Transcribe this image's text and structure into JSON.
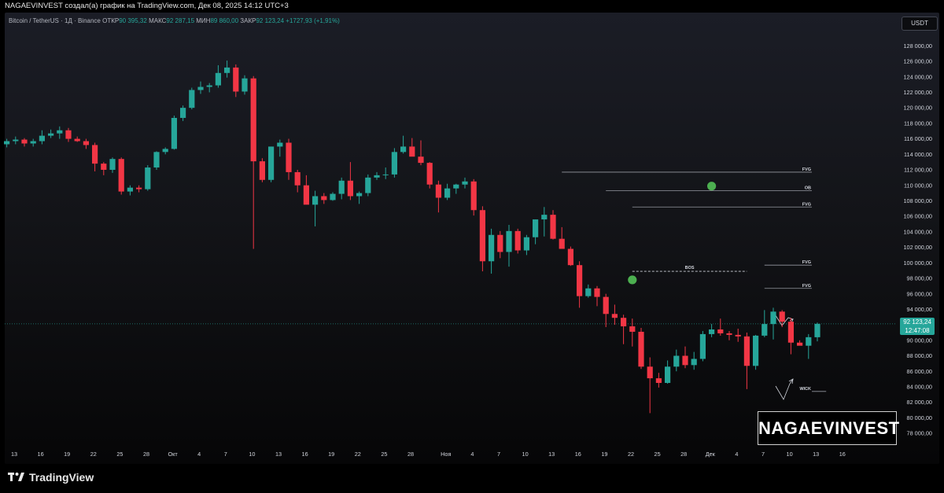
{
  "header": {
    "title": "NAGAEVINVEST создал(а) график на TradingView.com, Дек 08, 2025 14:12 UTC+3"
  },
  "ohlc": {
    "symbol": "Bitcoin / TetherUS · 1Д · Binance",
    "open_label": "ОТКР",
    "open": "90 395,32",
    "high_label": "МАКС",
    "high": "92 287,15",
    "low_label": "МИН",
    "low": "89 860,00",
    "close_label": "ЗАКР",
    "close": "92 123,24",
    "change": "+1727,93 (+1,91%)"
  },
  "currency": "USDT",
  "current_price": {
    "price": "92 123,24",
    "countdown": "12:47:08"
  },
  "watermark": "NAGAEVINVEST",
  "footer": {
    "logo_text": "TradingView"
  },
  "colors": {
    "up": "#26a69a",
    "down": "#f23645",
    "level_line": "#9598a1",
    "marker": "#4caf50",
    "price_line": "#26a69a"
  },
  "chart_data": {
    "type": "candlestick",
    "title": "Bitcoin / TetherUS · 1Д · Binance",
    "ylim": [
      77000,
      129000
    ],
    "y_ticks": [
      78000,
      80000,
      82000,
      84000,
      86000,
      88000,
      90000,
      92000,
      94000,
      96000,
      98000,
      100000,
      102000,
      104000,
      106000,
      108000,
      110000,
      112000,
      114000,
      116000,
      118000,
      120000,
      122000,
      124000,
      126000,
      128000
    ],
    "y_tick_labels": [
      "78 000,00",
      "80 000,00",
      "82 000,00",
      "84 000,00",
      "86 000,00",
      "88 000,00",
      "90 000,00",
      "92 000,00",
      "94 000,00",
      "96 000,00",
      "98 000,00",
      "100 000,00",
      "102 000,00",
      "104 000,00",
      "106 000,00",
      "108 000,00",
      "110 000,00",
      "112 000,00",
      "114 000,00",
      "116 000,00",
      "118 000,00",
      "120 000,00",
      "122 000,00",
      "124 000,00",
      "126 000,00",
      "128 000,00"
    ],
    "x_ticks": [
      {
        "label": "13",
        "i": 0
      },
      {
        "label": "16",
        "i": 3
      },
      {
        "label": "19",
        "i": 6
      },
      {
        "label": "22",
        "i": 9
      },
      {
        "label": "25",
        "i": 12
      },
      {
        "label": "28",
        "i": 15
      },
      {
        "label": "Окт",
        "i": 18
      },
      {
        "label": "4",
        "i": 21
      },
      {
        "label": "7",
        "i": 24
      },
      {
        "label": "10",
        "i": 27
      },
      {
        "label": "13",
        "i": 30
      },
      {
        "label": "16",
        "i": 33
      },
      {
        "label": "19",
        "i": 36
      },
      {
        "label": "22",
        "i": 39
      },
      {
        "label": "25",
        "i": 42
      },
      {
        "label": "28",
        "i": 45
      },
      {
        "label": "Ноя",
        "i": 49
      },
      {
        "label": "4",
        "i": 52
      },
      {
        "label": "7",
        "i": 55
      },
      {
        "label": "10",
        "i": 58
      },
      {
        "label": "13",
        "i": 61
      },
      {
        "label": "16",
        "i": 64
      },
      {
        "label": "19",
        "i": 67
      },
      {
        "label": "22",
        "i": 70
      },
      {
        "label": "25",
        "i": 73
      },
      {
        "label": "28",
        "i": 76
      },
      {
        "label": "Дек",
        "i": 79
      },
      {
        "label": "4",
        "i": 82
      },
      {
        "label": "7",
        "i": 85
      },
      {
        "label": "10",
        "i": 88
      },
      {
        "label": "13",
        "i": 91
      },
      {
        "label": "16",
        "i": 94
      }
    ],
    "candles": [
      [
        115300,
        116000,
        114900,
        115700
      ],
      [
        115700,
        116300,
        115300,
        115900
      ],
      [
        115900,
        116100,
        115000,
        115400
      ],
      [
        115400,
        116000,
        115000,
        115700
      ],
      [
        115700,
        117100,
        115300,
        116400
      ],
      [
        116400,
        117200,
        116100,
        116700
      ],
      [
        116700,
        117600,
        116000,
        117100
      ],
      [
        117100,
        117400,
        115600,
        116000
      ],
      [
        116000,
        116300,
        115600,
        115700
      ],
      [
        115700,
        116000,
        114700,
        115200
      ],
      [
        115200,
        115500,
        111800,
        112800
      ],
      [
        112800,
        113000,
        111300,
        112000
      ],
      [
        112000,
        113600,
        111600,
        113400
      ],
      [
        113400,
        113600,
        108800,
        109200
      ],
      [
        109200,
        110000,
        108700,
        109700
      ],
      [
        109700,
        110000,
        109100,
        109500
      ],
      [
        109500,
        112600,
        109300,
        112300
      ],
      [
        112300,
        114400,
        112000,
        114300
      ],
      [
        114300,
        114900,
        114000,
        114700
      ],
      [
        114700,
        119000,
        114600,
        118700
      ],
      [
        118700,
        120300,
        118300,
        120000
      ],
      [
        120000,
        122600,
        119800,
        122300
      ],
      [
        122300,
        123400,
        121800,
        122700
      ],
      [
        122700,
        123200,
        122000,
        122900
      ],
      [
        122900,
        125500,
        122600,
        124500
      ],
      [
        124500,
        126100,
        123900,
        125200
      ],
      [
        125200,
        125600,
        121400,
        122100
      ],
      [
        122100,
        124200,
        121700,
        123800
      ],
      [
        123800,
        124100,
        101800,
        113100
      ],
      [
        113100,
        113500,
        110400,
        110700
      ],
      [
        110700,
        115000,
        110400,
        115000
      ],
      [
        115000,
        115900,
        113700,
        115500
      ],
      [
        115500,
        116000,
        110700,
        111700
      ],
      [
        111700,
        112000,
        109100,
        110000
      ],
      [
        110000,
        111300,
        107700,
        107500
      ],
      [
        107500,
        109300,
        104700,
        108600
      ],
      [
        108600,
        109000,
        107600,
        108100
      ],
      [
        108100,
        109100,
        108000,
        108900
      ],
      [
        108900,
        111000,
        108200,
        110600
      ],
      [
        110600,
        113000,
        108100,
        108600
      ],
      [
        108600,
        109200,
        107600,
        109000
      ],
      [
        109000,
        111400,
        108600,
        111000
      ],
      [
        111000,
        111700,
        110700,
        111300
      ],
      [
        111300,
        112300,
        110800,
        111400
      ],
      [
        111400,
        114800,
        111000,
        114300
      ],
      [
        114300,
        116400,
        114100,
        115000
      ],
      [
        115000,
        116100,
        113800,
        113700
      ],
      [
        113700,
        115800,
        112600,
        112900
      ],
      [
        112900,
        113000,
        109600,
        110100
      ],
      [
        110100,
        110600,
        106500,
        108400
      ],
      [
        108400,
        110200,
        108100,
        109600
      ],
      [
        109600,
        110200,
        108900,
        110100
      ],
      [
        110100,
        111000,
        109600,
        110500
      ],
      [
        110500,
        110800,
        106100,
        106800
      ],
      [
        106800,
        107300,
        98900,
        100200
      ],
      [
        100200,
        104400,
        98600,
        103600
      ],
      [
        103600,
        104100,
        100600,
        101400
      ],
      [
        101400,
        104900,
        99500,
        104100
      ],
      [
        104100,
        104400,
        101200,
        101600
      ],
      [
        101600,
        103600,
        101000,
        103300
      ],
      [
        103300,
        105600,
        102400,
        105600
      ],
      [
        105600,
        107200,
        103400,
        106200
      ],
      [
        106200,
        106800,
        103000,
        103100
      ],
      [
        103100,
        104600,
        101900,
        101800
      ],
      [
        101800,
        102100,
        99600,
        99700
      ],
      [
        99700,
        100200,
        94200,
        95700
      ],
      [
        95700,
        97200,
        95500,
        96700
      ],
      [
        96700,
        97000,
        94400,
        95600
      ],
      [
        95600,
        96000,
        91700,
        93400
      ],
      [
        93400,
        94600,
        92000,
        92900
      ],
      [
        92900,
        93300,
        89500,
        91800
      ],
      [
        91800,
        92800,
        89200,
        91100
      ],
      [
        91100,
        91600,
        86300,
        86600
      ],
      [
        86600,
        87800,
        80600,
        85100
      ],
      [
        85100,
        85800,
        83900,
        84500
      ],
      [
        84500,
        87400,
        84400,
        86600
      ],
      [
        86600,
        88800,
        86000,
        88000
      ],
      [
        88000,
        89200,
        86400,
        86800
      ],
      [
        86800,
        88500,
        86200,
        87600
      ],
      [
        87600,
        91200,
        87300,
        90800
      ],
      [
        90800,
        92100,
        90400,
        91400
      ],
      [
        91400,
        92800,
        90600,
        90900
      ],
      [
        90900,
        91200,
        90000,
        90700
      ],
      [
        90700,
        91500,
        89800,
        90500
      ],
      [
        90500,
        91000,
        83700,
        86700
      ],
      [
        86700,
        90700,
        86200,
        90600
      ],
      [
        90600,
        93900,
        90400,
        92100
      ],
      [
        92100,
        94200,
        90100,
        93700
      ],
      [
        93700,
        93900,
        91700,
        92400
      ],
      [
        92400,
        92900,
        88200,
        89700
      ],
      [
        89700,
        90000,
        89500,
        89300
      ],
      [
        89300,
        90800,
        87600,
        90400
      ],
      [
        90395.32,
        92287.15,
        89860,
        92123.24
      ]
    ],
    "levels": [
      {
        "label": "FVG",
        "price": 111700,
        "from_i": 63
      },
      {
        "label": "OB",
        "price": 109300,
        "from_i": 68
      },
      {
        "label": "FVG",
        "price": 107200,
        "from_i": 71
      },
      {
        "label": "FVG",
        "price": 99700,
        "from_i": 86
      },
      {
        "label": "FVG",
        "price": 96700,
        "from_i": 86
      },
      {
        "label": "WICK",
        "price": 83400,
        "from_i": 93
      }
    ],
    "bos": {
      "label": "BOS",
      "price": 98900,
      "from_i": 71,
      "to_i": 84
    },
    "markers": [
      {
        "i": 71,
        "price": 97800
      },
      {
        "i": 80,
        "price": 109900
      },
      {
        "i": 93,
        "price": 77800
      }
    ],
    "current_price": 92123.24
  }
}
